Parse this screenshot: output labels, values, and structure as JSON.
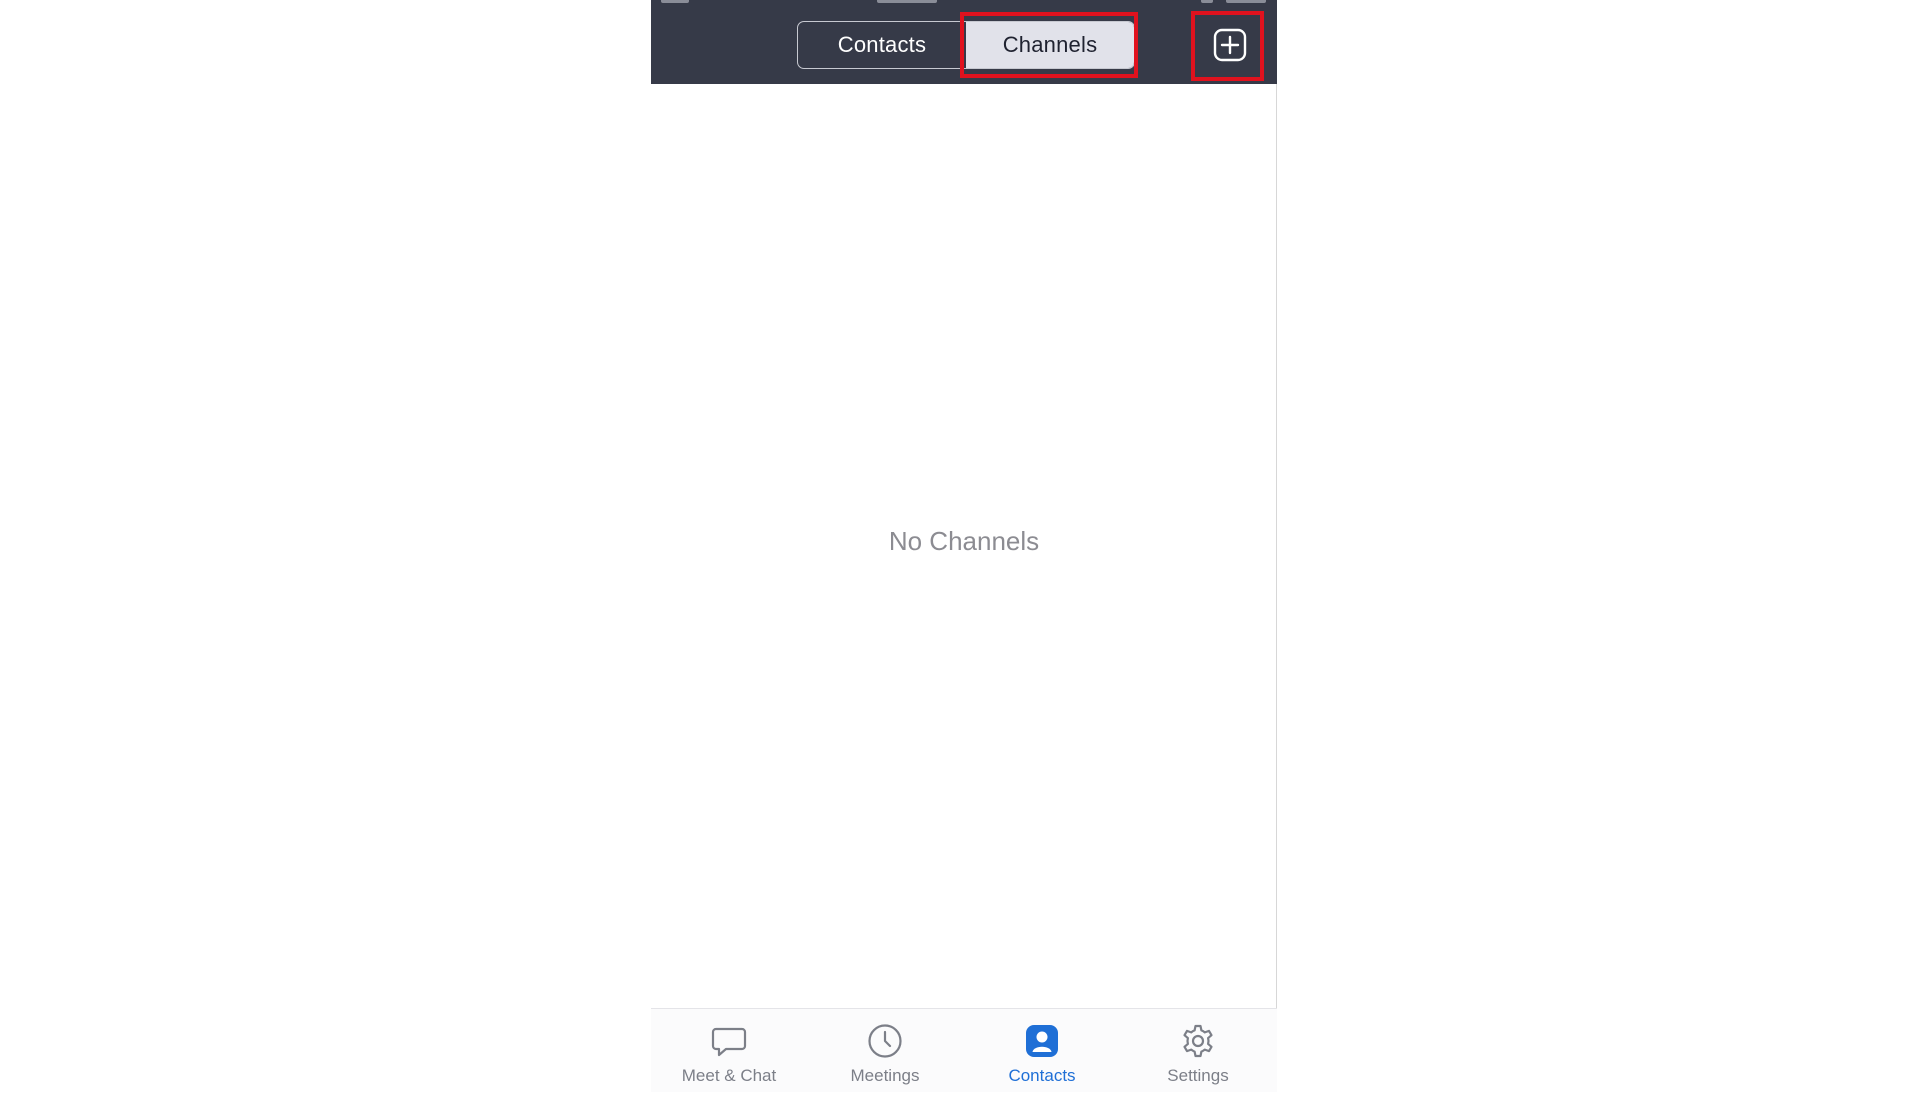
{
  "header": {
    "segments": [
      {
        "label": "Contacts",
        "active": false
      },
      {
        "label": "Channels",
        "active": true
      }
    ],
    "add_icon": "plus-square-icon"
  },
  "main": {
    "empty_text": "No Channels"
  },
  "tabbar": {
    "items": [
      {
        "label": "Meet & Chat",
        "icon": "chat-bubble-icon",
        "active": false
      },
      {
        "label": "Meetings",
        "icon": "clock-icon",
        "active": false
      },
      {
        "label": "Contacts",
        "icon": "contact-card-icon",
        "active": true
      },
      {
        "label": "Settings",
        "icon": "gear-icon",
        "active": false
      }
    ]
  },
  "colors": {
    "header_bg": "#363a48",
    "active_segment_bg": "#e1e2ea",
    "highlight": "#e0121e",
    "active_tab": "#1f6fd6",
    "empty_text": "#8c8c92"
  }
}
